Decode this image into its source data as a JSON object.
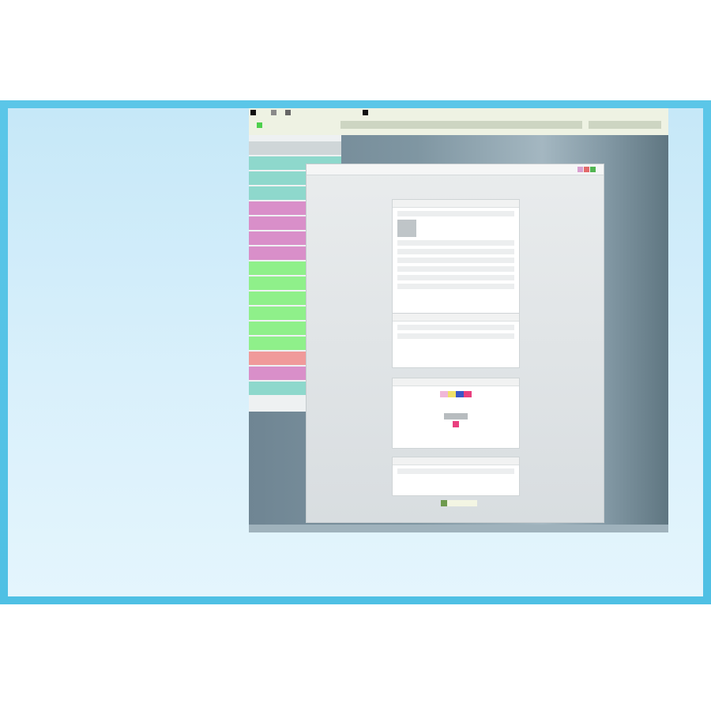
{
  "left_text": {
    "lines": [
      "",
      "",
      "",
      "",
      "",
      "",
      "",
      "",
      "",
      "",
      "",
      "",
      "",
      "",
      "",
      "",
      "",
      "",
      "",
      "",
      "",
      "",
      "",
      "",
      "",
      "",
      ""
    ]
  },
  "caption": {
    "lines": [
      "",
      "",
      ""
    ]
  },
  "screenshot": {
    "sidebar_items": [
      "",
      "",
      "",
      "",
      "",
      "",
      "",
      "",
      "",
      "",
      "",
      "",
      "",
      "",
      "",
      "",
      ""
    ],
    "panels": [
      {
        "header": ""
      },
      {
        "header": ""
      },
      {
        "header": ""
      },
      {
        "header": ""
      }
    ]
  },
  "colors": {
    "frame": "#5bc6e8",
    "slide_bg": "#d3eefa",
    "text": "#2a66b5",
    "sidebar_pink": "#d98fc9",
    "sidebar_green": "#8ff08a",
    "sidebar_teal": "#8ed8cc",
    "sidebar_salmon": "#f09a9a"
  }
}
